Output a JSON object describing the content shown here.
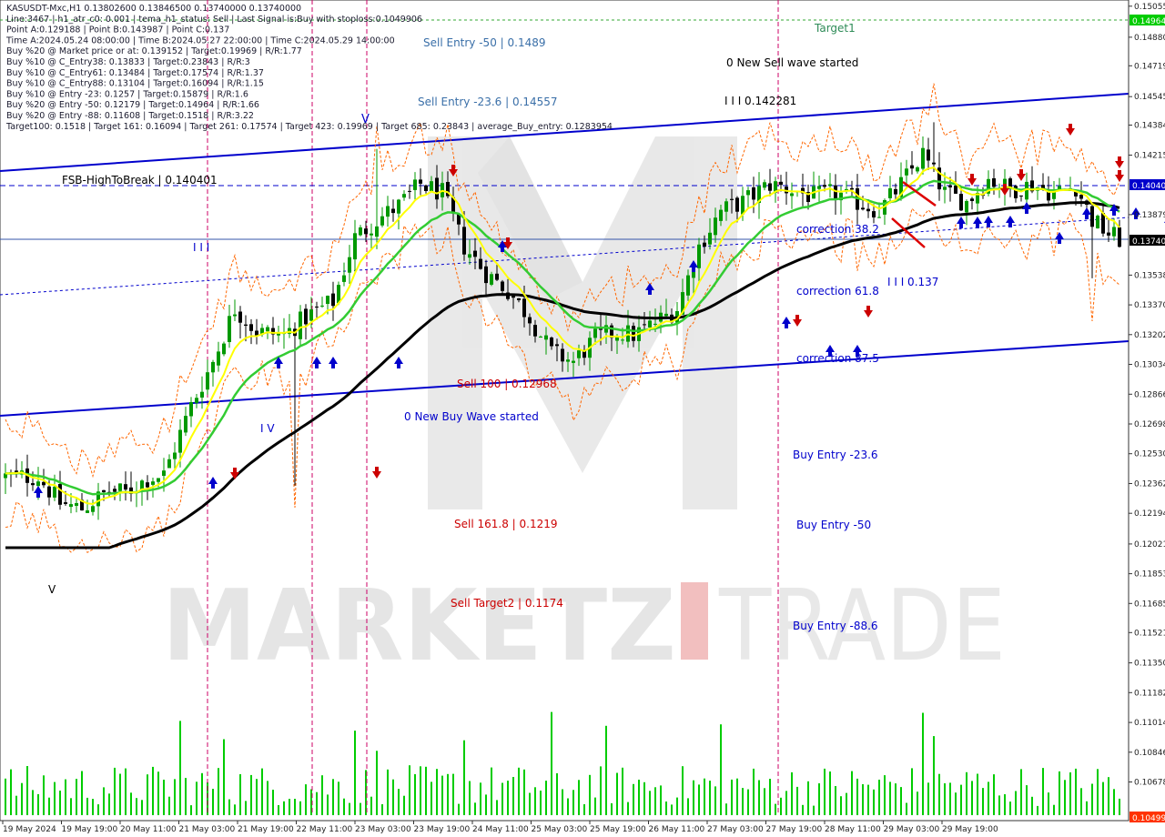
{
  "header_lines": [
    "KASUSDT-Mxc,H1  0.13802600 0.13846500 0.13740000 0.13740000",
    "Line:3467 | h1_atr_c0: 0.001 | tema_h1_status: Sell | Last Signal is:Buy with stoploss:0.1049906",
    "Point A:0.129188 | Point B:0.143987 | Point C:0.137",
    "Time A:2024.05.24 08:00:00 | Time B:2024.05.27 22:00:00 | Time C:2024.05.29 14:00:00",
    "Buy %20 @ Market price or at: 0.139152 | Target:0.19969 | R/R:1.77",
    "Buy %10 @ C_Entry38: 0.13833 | Target:0.23843 | R/R:3",
    "Buy %10 @ C_Entry61: 0.13484 | Target:0.17574 | R/R:1.37",
    "Buy %10 @ C_Entry88: 0.13104 | Target:0.16094 | R/R:1.15",
    "Buy %10 @ Entry -23: 0.1257 | Target:0.15879 | R/R:1.6",
    "Buy %20 @ Entry -50: 0.12179 | Target:0.14964 | R/R:1.66",
    "Buy %20 @ Entry -88: 0.11608 | Target:0.1518 | R/R:3.22",
    "Target100: 0.1518 | Target 161: 0.16094 | Target 261: 0.17574 | Target 423: 0.19969 | Target 685: 0.23843 | average_Buy_entry: 0.1283954"
  ],
  "watermark": {
    "left": "MARKETZ",
    "right": "TRADE"
  },
  "annotations": {
    "sell_entry_50": "Sell Entry -50 | 0.1489",
    "sell_entry_23": "Sell Entry -23.6 | 0.14557",
    "target1": "Target1",
    "new_sell_wave": "0 New Sell wave started",
    "wave_top": "I I I 0.142281",
    "fsb": "FSB-HighToBreak | 0.140401",
    "correction_38": "correction 38.2",
    "correction_61": "correction 61.8",
    "correction_87": "correction 87.5",
    "wave_c": "I I I 0.137",
    "wave_iii": "I I I",
    "wave_iv": "I V",
    "wave_v": "V",
    "wave_low_label": "Sell 100 | 0.12968",
    "new_buy_wave": "0 New Buy Wave started",
    "buy_entry_23": "Buy Entry -23.6",
    "buy_entry_50": "Buy Entry -50",
    "buy_entry_88": "Buy Entry -88.6",
    "sell_161": "Sell 161.8 | 0.1219",
    "sell_target2": "Sell Target2 | 0.1174"
  },
  "price_tags": {
    "top": "0.14964",
    "fsb": "0.14040",
    "current": "0.13740",
    "bottom": "0.10499"
  },
  "colors": {
    "bull": "#009900",
    "bear": "#000000",
    "ema_yellow": "#ffff00",
    "ema_green": "#33cc33",
    "ema_black": "#000000",
    "channel_blue": "#0000cc",
    "vline_magenta": "#cc0066",
    "band_orange": "#ff6600",
    "sell_red": "#cc0000",
    "buy_blue": "#0000cc",
    "volume_green": "#00cc00",
    "fsb_tag_bg": "#0000cc",
    "current_tag_bg": "#000000",
    "top_tag_bg": "#00cc00",
    "bottom_tag_bg": "#ff3300"
  },
  "chart_data": {
    "type": "candlestick",
    "symbol": "KASUSDT-Mxc",
    "timeframe": "H1",
    "y_ticks": [
      "0.15055",
      "0.14880",
      "0.14719",
      "0.14545",
      "0.14384",
      "0.14215",
      "0.13879",
      "0.13538",
      "0.13370",
      "0.13202",
      "0.13034",
      "0.12866",
      "0.12698",
      "0.12530",
      "0.12362",
      "0.12194",
      "0.12021",
      "0.11853",
      "0.11685",
      "0.11521",
      "0.11350",
      "0.11182",
      "0.11014",
      "0.10846",
      "0.10678"
    ],
    "ylim": [
      0.1046,
      0.1509
    ],
    "x_ticks": [
      "19 May 2024",
      "19 May 19:00",
      "20 May 11:00",
      "21 May 03:00",
      "21 May 19:00",
      "22 May 11:00",
      "23 May 03:00",
      "23 May 19:00",
      "24 May 11:00",
      "25 May 03:00",
      "25 May 19:00",
      "26 May 11:00",
      "27 May 03:00",
      "27 May 19:00",
      "28 May 11:00",
      "29 May 03:00",
      "29 May 19:00"
    ],
    "levels": {
      "target1": 0.14964,
      "fsb_high_to_break": 0.140401,
      "current_price": 0.1374,
      "sell_entry_50": 0.1489,
      "sell_entry_23_6": 0.14557,
      "wave_top": 0.142281,
      "wave_c": 0.137,
      "wave_a": 0.129188,
      "sell_161_8": 0.1219,
      "sell_target2": 0.1174
    },
    "close_path": [
      [
        0,
        0.124
      ],
      [
        6,
        0.124
      ],
      [
        10,
        0.1225
      ],
      [
        14,
        0.1222
      ],
      [
        19,
        0.1232
      ],
      [
        22,
        0.1231
      ],
      [
        26,
        0.1239
      ],
      [
        29,
        0.1241
      ],
      [
        34,
        0.128
      ],
      [
        38,
        0.1305
      ],
      [
        42,
        0.1335
      ],
      [
        46,
        0.1322
      ],
      [
        51,
        0.132
      ],
      [
        55,
        0.133
      ],
      [
        60,
        0.1339
      ],
      [
        64,
        0.1375
      ],
      [
        68,
        0.1385
      ],
      [
        72,
        0.1393
      ],
      [
        76,
        0.1405
      ],
      [
        80,
        0.14
      ],
      [
        84,
        0.137
      ],
      [
        88,
        0.1355
      ],
      [
        92,
        0.1345
      ],
      [
        96,
        0.133
      ],
      [
        100,
        0.131
      ],
      [
        104,
        0.1305
      ],
      [
        108,
        0.1318
      ],
      [
        112,
        0.1322
      ],
      [
        115,
        0.132
      ],
      [
        119,
        0.1327
      ],
      [
        123,
        0.1335
      ],
      [
        127,
        0.137
      ],
      [
        131,
        0.139
      ],
      [
        135,
        0.1395
      ],
      [
        140,
        0.1405
      ],
      [
        144,
        0.1402
      ],
      [
        148,
        0.1398
      ],
      [
        152,
        0.14
      ],
      [
        156,
        0.1395
      ],
      [
        160,
        0.139
      ],
      [
        164,
        0.1405
      ],
      [
        168,
        0.1422
      ],
      [
        172,
        0.14
      ],
      [
        176,
        0.1395
      ],
      [
        180,
        0.1408
      ],
      [
        184,
        0.1402
      ],
      [
        188,
        0.1405
      ],
      [
        192,
        0.14
      ],
      [
        196,
        0.1404
      ],
      [
        199,
        0.1385
      ],
      [
        202,
        0.1377
      ],
      [
        204,
        0.1374
      ]
    ]
  }
}
